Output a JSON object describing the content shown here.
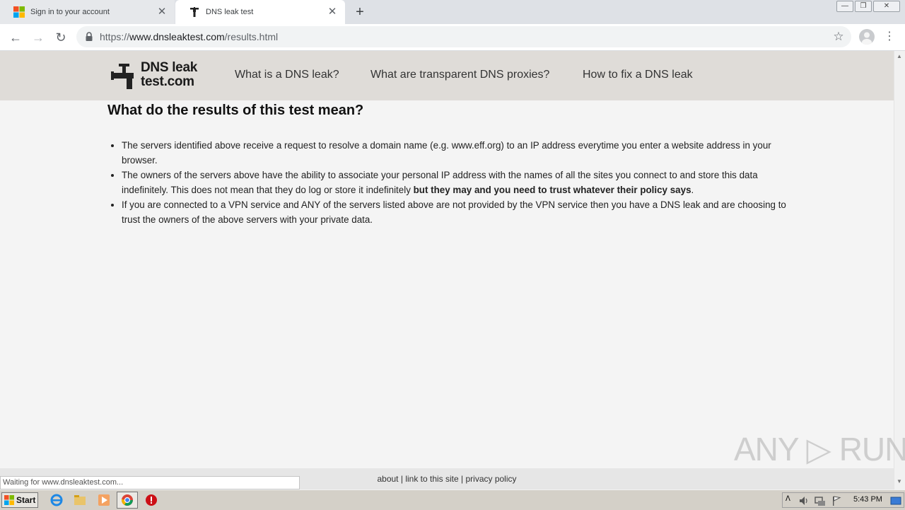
{
  "tabs": [
    {
      "title": "Sign in to your account",
      "close": "✕",
      "active": false
    },
    {
      "title": "DNS leak test",
      "close": "✕",
      "active": true
    }
  ],
  "new_tab": "+",
  "window_controls": {
    "minimize": "—",
    "restore": "❐",
    "close": "✕"
  },
  "toolbar": {
    "back": "←",
    "forward": "→",
    "reload": "↻",
    "star": "☆",
    "menu": "⋮"
  },
  "address_bar": {
    "scheme": "https://",
    "host": "www.dnsleaktest.com",
    "path": "/results.html"
  },
  "site": {
    "logo_line1": "DNS leak",
    "logo_line2": "test.com",
    "nav": [
      "What is a DNS leak?",
      "What are transparent DNS proxies?",
      "How to fix a DNS leak"
    ]
  },
  "content": {
    "heading": "What do the results of this test mean?",
    "bullet1": "The servers identified above receive a request to resolve a domain name (e.g. www.eff.org) to an IP address everytime you enter a website address in your browser.",
    "bullet2_text": "The owners of the servers above have the ability to associate your personal IP address with the names of all the sites you connect to and store this data indefinitely. This does not mean that they do log or store it indefinitely ",
    "bullet2_bold": "but they may and you need to trust whatever their policy says",
    "bullet2_end": ".",
    "bullet3": "If you are connected to a VPN service and ANY of the servers listed above are not provided by the VPN service then you have a DNS leak and are choosing to trust the owners of the above servers with your private data."
  },
  "footer": {
    "about": "about",
    "sep1": " | ",
    "link": "link to this site",
    "sep2": " | ",
    "privacy": "privacy policy"
  },
  "status_bar": "Waiting for www.dnsleaktest.com...",
  "watermark": "ANY ▷ RUN",
  "taskbar": {
    "start_label": "Start",
    "clock": "5:43 PM",
    "tray_up": "ᐱ"
  },
  "scrollbar": {
    "up": "▲",
    "down": "▼"
  }
}
